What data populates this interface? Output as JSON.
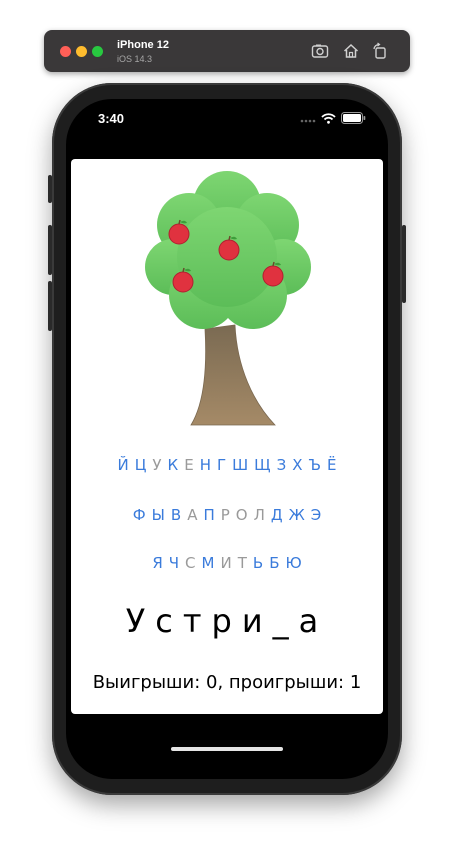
{
  "simulator": {
    "device": "iPhone 12",
    "os": "iOS 14.3",
    "icons": [
      "screenshot-icon",
      "home-icon",
      "rotate-icon"
    ]
  },
  "status_bar": {
    "time": "3:40",
    "icons": [
      "signal-icon",
      "wifi-icon",
      "battery-icon"
    ]
  },
  "game": {
    "tree_icon": "apple-tree-icon",
    "apples_count": 4,
    "keyboard": {
      "rows": [
        [
          {
            "letter": "Й",
            "state": "active"
          },
          {
            "letter": "Ц",
            "state": "active"
          },
          {
            "letter": "У",
            "state": "used"
          },
          {
            "letter": "К",
            "state": "active"
          },
          {
            "letter": "Е",
            "state": "used"
          },
          {
            "letter": "Н",
            "state": "active"
          },
          {
            "letter": "Г",
            "state": "active"
          },
          {
            "letter": "Ш",
            "state": "active"
          },
          {
            "letter": "Щ",
            "state": "active"
          },
          {
            "letter": "З",
            "state": "active"
          },
          {
            "letter": "Х",
            "state": "active"
          },
          {
            "letter": "Ъ",
            "state": "active"
          },
          {
            "letter": "Ё",
            "state": "active"
          }
        ],
        [
          {
            "letter": "Ф",
            "state": "active"
          },
          {
            "letter": "Ы",
            "state": "active"
          },
          {
            "letter": "В",
            "state": "active"
          },
          {
            "letter": "А",
            "state": "used"
          },
          {
            "letter": "П",
            "state": "active"
          },
          {
            "letter": "Р",
            "state": "used"
          },
          {
            "letter": "О",
            "state": "used"
          },
          {
            "letter": "Л",
            "state": "used"
          },
          {
            "letter": "Д",
            "state": "active"
          },
          {
            "letter": "Ж",
            "state": "active"
          },
          {
            "letter": "Э",
            "state": "active"
          }
        ],
        [
          {
            "letter": "Я",
            "state": "active"
          },
          {
            "letter": "Ч",
            "state": "active"
          },
          {
            "letter": "С",
            "state": "used"
          },
          {
            "letter": "М",
            "state": "active"
          },
          {
            "letter": "И",
            "state": "used"
          },
          {
            "letter": "Т",
            "state": "used"
          },
          {
            "letter": "Ь",
            "state": "active"
          },
          {
            "letter": "Б",
            "state": "active"
          },
          {
            "letter": "Ю",
            "state": "active"
          }
        ]
      ]
    },
    "word_display": "Устри_а",
    "score_text": "Выигрыши: 0, проигрыши: 1"
  },
  "colors": {
    "active_letter": "#3a7bdb",
    "used_letter": "#9a9a9a",
    "foliage": "#6bc866",
    "trunk": "#9b8160",
    "apple": "#e0323f"
  }
}
